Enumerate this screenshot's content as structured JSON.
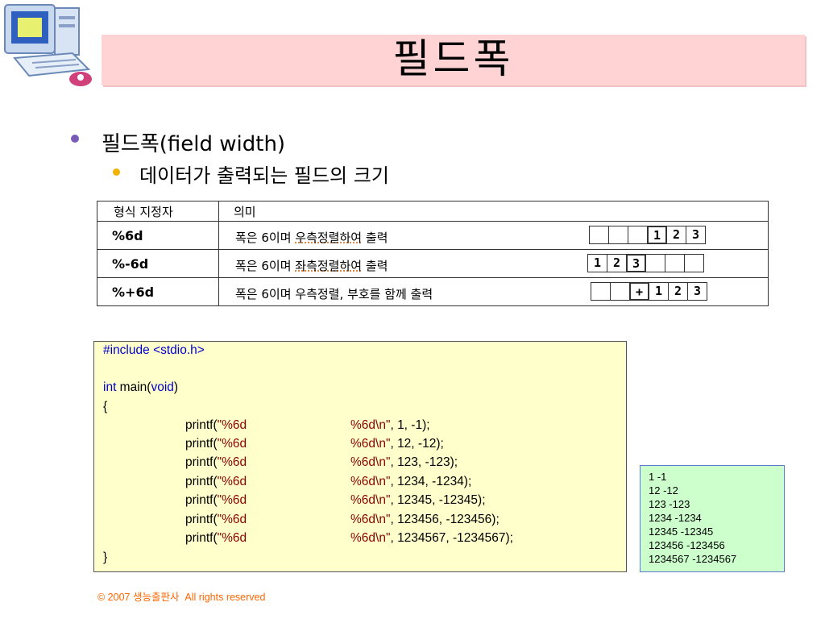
{
  "slide": {
    "title": "필드폭",
    "bullets": [
      {
        "text": "필드폭(field width)"
      },
      {
        "text": "데이터가 출력되는 필드의 크기"
      }
    ]
  },
  "table": {
    "headers": [
      "형식 지정자",
      "의미"
    ],
    "rows": [
      {
        "spec": "%6d",
        "desc_pre": "폭은 6이며 ",
        "desc_mark": "우측정렬하여",
        "desc_post": " 출력",
        "cells": [
          "",
          "",
          "",
          "1",
          "2",
          "3"
        ]
      },
      {
        "spec": "%-6d",
        "desc_pre": "폭은 6이며 ",
        "desc_mark": "좌측정렬하여",
        "desc_post": " 출력",
        "cells": [
          "1",
          "2",
          "3",
          "",
          "",
          ""
        ]
      },
      {
        "spec": "%+6d",
        "desc_pre": "폭은 6이며 우측정렬, 부호를 함께 출력",
        "desc_mark": "",
        "desc_post": "",
        "cells": [
          "",
          "",
          "+",
          "1",
          "2",
          "3"
        ]
      }
    ]
  },
  "code": {
    "include_kw": "#include",
    "include_hdr": "<stdio.h>",
    "int_kw": "int",
    "main_pre": " main(",
    "void_kw": "void",
    "main_post": ")",
    "open_brace": "{",
    "close_brace": "}",
    "printf_lines": [
      {
        "fn": "printf(",
        "fmt1": "\"%6d",
        "fmt2": "%6d\\n\"",
        "args": ", 1, -1);"
      },
      {
        "fn": "printf(",
        "fmt1": "\"%6d",
        "fmt2": "%6d\\n\"",
        "args": ", 12, -12);"
      },
      {
        "fn": "printf(",
        "fmt1": "\"%6d",
        "fmt2": "%6d\\n\"",
        "args": ", 123, -123);"
      },
      {
        "fn": "printf(",
        "fmt1": "\"%6d",
        "fmt2": "%6d\\n\"",
        "args": ", 1234, -1234);"
      },
      {
        "fn": "printf(",
        "fmt1": "\"%6d",
        "fmt2": "%6d\\n\"",
        "args": ", 12345, -12345);"
      },
      {
        "fn": "printf(",
        "fmt1": "\"%6d",
        "fmt2": "%6d\\n\"",
        "args": ", 123456, -123456);"
      },
      {
        "fn": "printf(",
        "fmt1": "\"%6d",
        "fmt2": "%6d\\n\"",
        "args": ", 1234567, -1234567);"
      }
    ]
  },
  "output": {
    "lines": [
      "1 -1",
      "12 -12",
      "123 -123",
      "1234 -1234",
      "12345 -12345",
      "123456 -123456",
      "1234567 -1234567"
    ]
  },
  "footer": {
    "text": "© 2007 생능출판사  All rights reserved"
  },
  "colors": {
    "title_band": "#ffd3d3",
    "code_bg": "#ffffcc",
    "output_bg": "#ccffcc",
    "keyword": "#0000cc",
    "string": "#8b0000",
    "footer": "#ff6600"
  },
  "icons": [
    "computer-clipart-icon"
  ]
}
